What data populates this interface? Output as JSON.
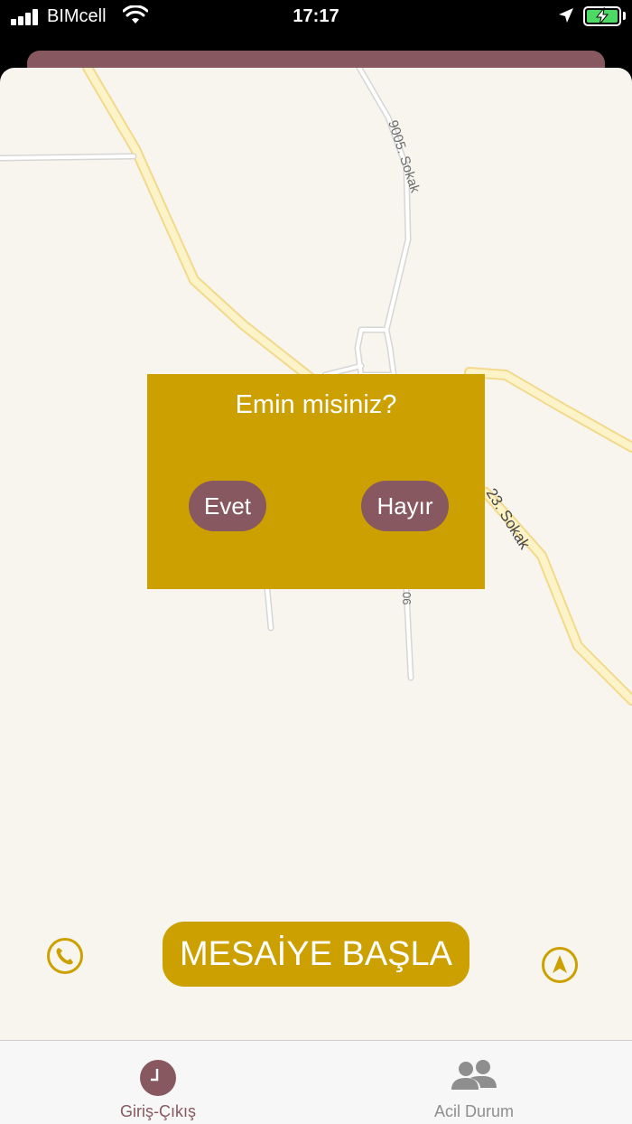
{
  "status_bar": {
    "carrier": "BIMcell",
    "time": "17:17"
  },
  "map": {
    "street_labels": [
      "9005. Sokak",
      "23. Sokak",
      "06"
    ]
  },
  "dialog": {
    "title": "Emin misiniz?",
    "yes_label": "Evet",
    "no_label": "Hayır"
  },
  "main": {
    "start_button_label": "MESAİYE BAŞLA"
  },
  "tab_bar": {
    "tabs": [
      {
        "label": "Giriş-Çıkış",
        "icon": "clock-icon",
        "active": true
      },
      {
        "label": "Acil Durum",
        "icon": "people-icon",
        "active": false
      }
    ]
  },
  "colors": {
    "accent": "#cca000",
    "brand": "#87585f",
    "background": "#f7f5ee",
    "road": "#fdf3c8",
    "battery": "#4cd964"
  }
}
